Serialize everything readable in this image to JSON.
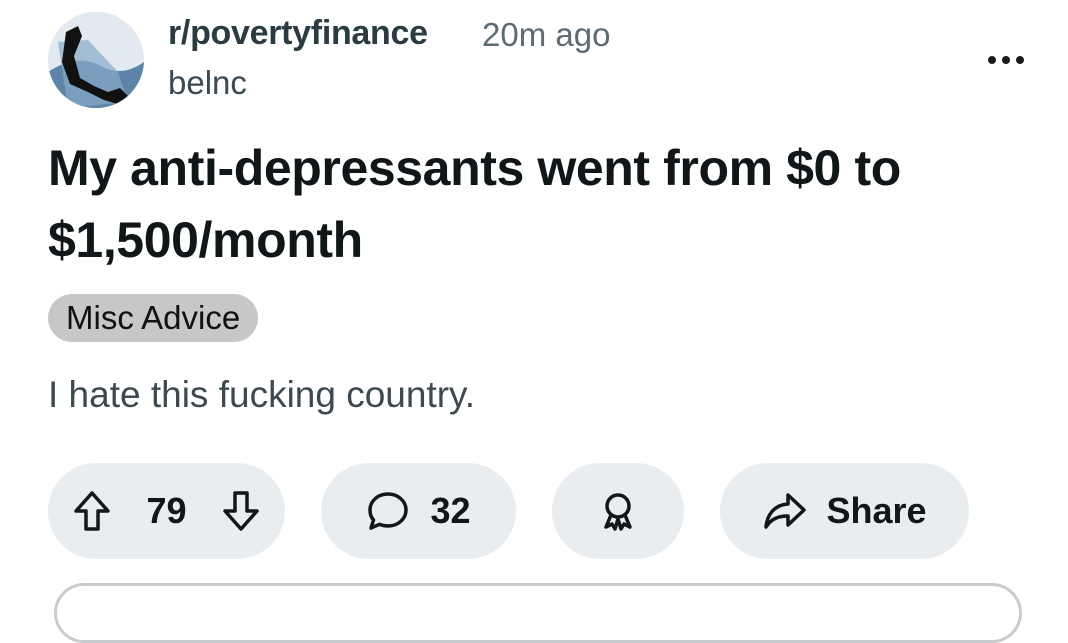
{
  "post": {
    "subreddit": "r/povertyfinance",
    "time_ago": "20m ago",
    "username": "belnc",
    "title": "My anti-depressants went from $0 to $1,500/month",
    "flair": "Misc Advice",
    "body": "I hate this fucking country."
  },
  "actions": {
    "upvote_count": "79",
    "comment_count": "32",
    "share_label": "Share"
  },
  "icons": {
    "more": "more-horizontal-icon",
    "upvote": "upvote-arrow-icon",
    "downvote": "downvote-arrow-icon",
    "comment": "comment-bubble-icon",
    "award": "award-icon",
    "share": "share-arrow-icon"
  },
  "colors": {
    "action_pill_bg": "#eaedef",
    "flair_bg": "#c7c7c7",
    "subreddit_text": "#2a3c42",
    "meta_text": "#5c6c74"
  }
}
